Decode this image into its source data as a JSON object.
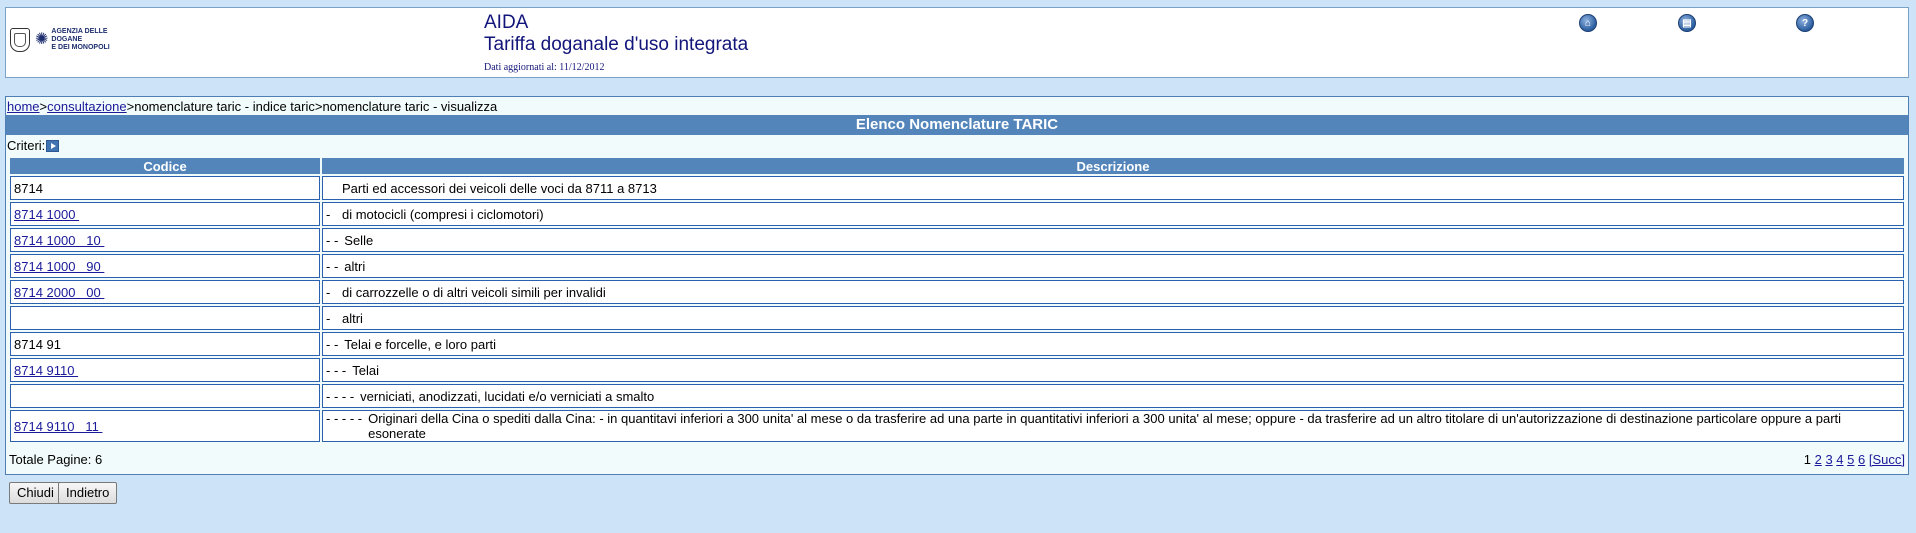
{
  "header": {
    "logo_text": "AGENZIA DELLE DOGANE\nE DEI MONOPOLI",
    "app_name": "AIDA",
    "app_subtitle": "Tariffa doganale d'uso integrata",
    "updated": "Dati aggiornati al: 11/12/2012",
    "icons": [
      "home-icon",
      "print-icon",
      "help-icon"
    ]
  },
  "breadcrumb": {
    "home": "home",
    "sep1": ">",
    "consultazione": "consultazione",
    "rest": ">nomenclature taric - indice taric>nomenclature taric - visualizza"
  },
  "title": "Elenco Nomenclature TARIC",
  "criteri_label": "Criteri:",
  "table": {
    "headers": {
      "code": "Codice",
      "desc": "Descrizione"
    },
    "rows": [
      {
        "code": "8714",
        "link": false,
        "dashes": "",
        "desc": "Parti ed accessori dei veicoli delle voci da 8711 a 8713"
      },
      {
        "code": "8714 1000 ",
        "link": true,
        "dashes": "-",
        "desc": "di motocicli (compresi i ciclomotori)"
      },
      {
        "code": "8714 1000   10 ",
        "link": true,
        "dashes": "- -",
        "desc": "Selle"
      },
      {
        "code": "8714 1000   90 ",
        "link": true,
        "dashes": "- -",
        "desc": "altri"
      },
      {
        "code": "8714 2000   00 ",
        "link": true,
        "dashes": "-",
        "desc": "di carrozzelle o di altri veicoli simili per invalidi"
      },
      {
        "code": "",
        "link": false,
        "dashes": "-",
        "desc": "altri"
      },
      {
        "code": "8714 91",
        "link": false,
        "dashes": "- -",
        "desc": "Telai e forcelle, e loro parti"
      },
      {
        "code": "8714 9110 ",
        "link": true,
        "dashes": "- - -",
        "desc": "Telai"
      },
      {
        "code": "",
        "link": false,
        "dashes": "- - - -",
        "desc": "verniciati, anodizzati, lucidati e/o verniciati a smalto"
      },
      {
        "code": "8714 9110   11 ",
        "link": true,
        "dashes": "- - - - -",
        "desc": "Originari della Cina o spediti dalla Cina: - in quantitavi inferiori a 300 unita' al mese o da trasferire ad una parte in quantitativi inferiori a 300 unita' al mese; oppure - da trasferire ad un altro titolare di un'autorizzazione di destinazione particolare oppure a parti esonerate"
      }
    ]
  },
  "footer": {
    "total_pages": "Totale Pagine: 6",
    "pages": [
      "1",
      "2",
      "3",
      "4",
      "5",
      "6"
    ],
    "current_page": "1",
    "next": "[Succ]"
  },
  "buttons": {
    "close": "Chiudi",
    "back": "Indietro"
  }
}
